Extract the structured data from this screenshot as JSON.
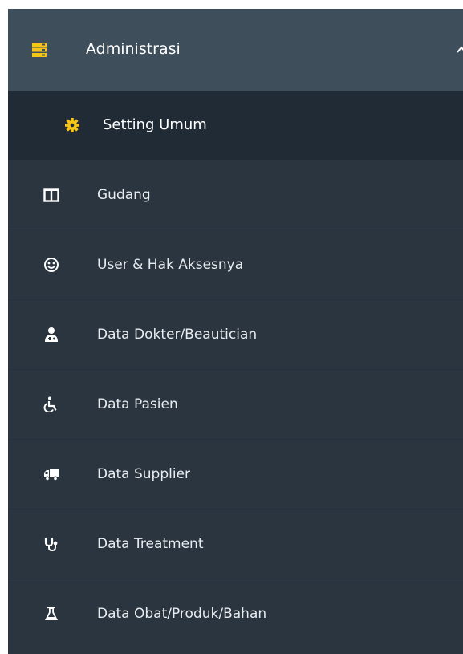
{
  "menu": {
    "header": {
      "label": "Administrasi",
      "icon": "server-icon",
      "accent": "#f5c518"
    },
    "items": [
      {
        "label": "Setting Umum",
        "icon": "gear-icon",
        "active": true,
        "icon_color": "#f5c518"
      },
      {
        "label": "Gudang",
        "icon": "columns-icon",
        "active": false
      },
      {
        "label": "User & Hak Aksesnya",
        "icon": "smile-icon",
        "active": false
      },
      {
        "label": "Data Dokter/Beautician",
        "icon": "user-md-icon",
        "active": false
      },
      {
        "label": "Data Pasien",
        "icon": "wheelchair-icon",
        "active": false
      },
      {
        "label": "Data Supplier",
        "icon": "truck-icon",
        "active": false
      },
      {
        "label": "Data Treatment",
        "icon": "stethoscope-icon",
        "active": false
      },
      {
        "label": "Data Obat/Produk/Bahan",
        "icon": "flask-icon",
        "active": false
      }
    ]
  },
  "colors": {
    "sidebar_bg": "#2a3540",
    "header_bg": "#3f4e5b",
    "active_bg": "#212b35"
  }
}
